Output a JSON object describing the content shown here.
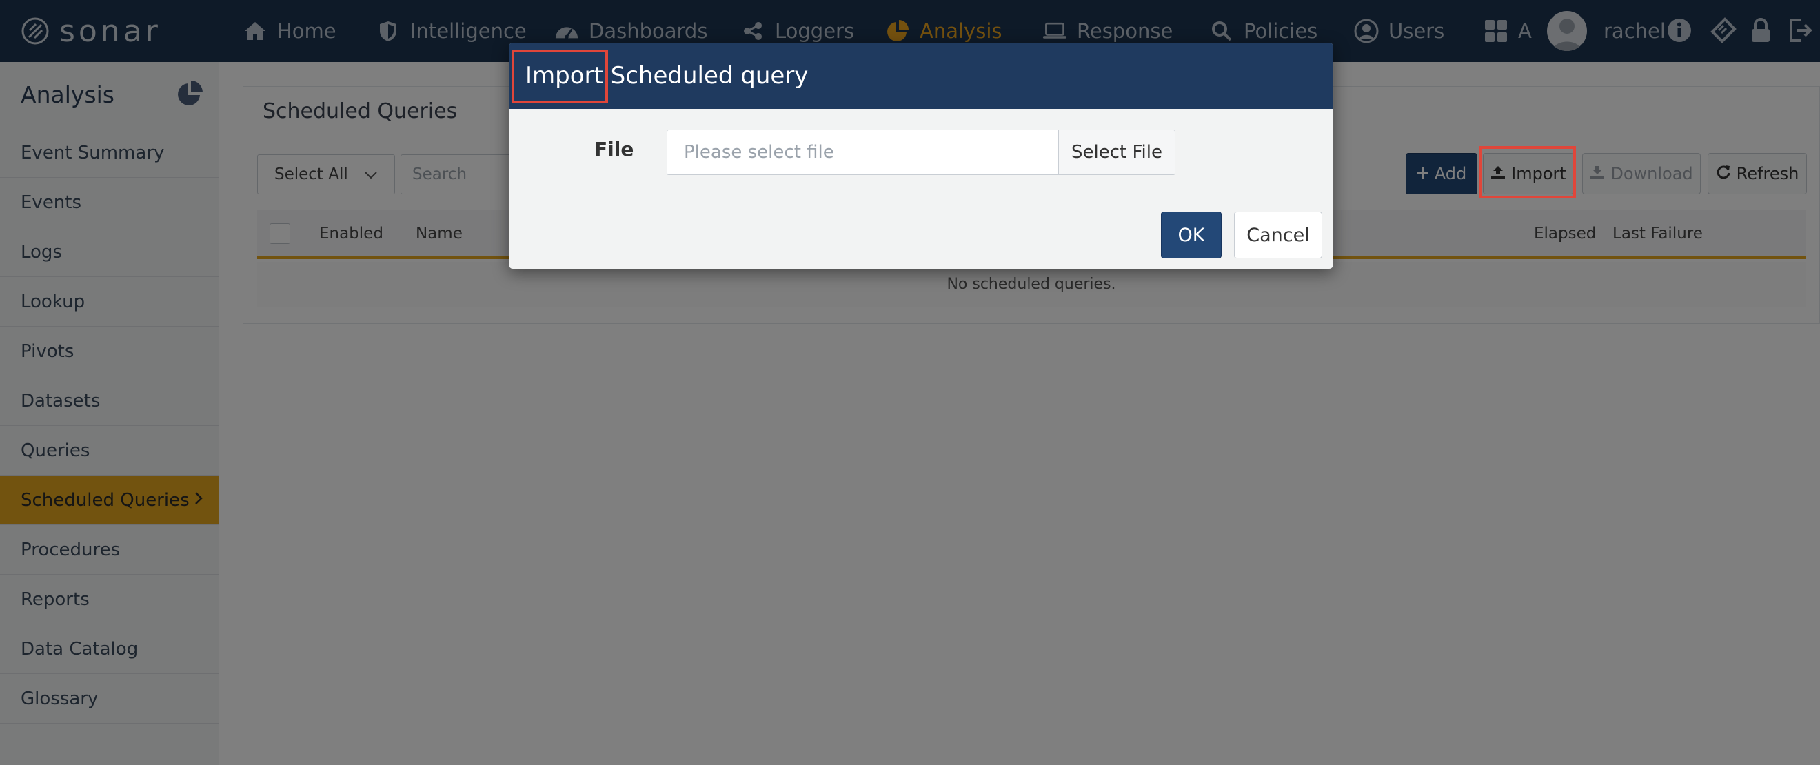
{
  "app": {
    "logo_text": "sonar"
  },
  "topnav": {
    "items": [
      {
        "label": "Home",
        "icon": "home-icon"
      },
      {
        "label": "Intelligence",
        "icon": "shield-icon"
      },
      {
        "label": "Dashboards",
        "icon": "gauge-icon"
      },
      {
        "label": "Loggers",
        "icon": "share-icon"
      },
      {
        "label": "Analysis",
        "icon": "pie-chart-icon",
        "active": true
      },
      {
        "label": "Response",
        "icon": "laptop-icon"
      },
      {
        "label": "Policies",
        "icon": "search-icon"
      },
      {
        "label": "Users",
        "icon": "user-circle-icon"
      },
      {
        "label": "A",
        "icon": "apps-grid-icon"
      }
    ],
    "username": "rachel",
    "active_color": "#e8a31e"
  },
  "sidebar": {
    "title": "Analysis",
    "items": [
      {
        "label": "Event Summary"
      },
      {
        "label": "Events"
      },
      {
        "label": "Logs"
      },
      {
        "label": "Lookup"
      },
      {
        "label": "Pivots"
      },
      {
        "label": "Datasets"
      },
      {
        "label": "Queries"
      },
      {
        "label": "Scheduled Queries",
        "active": true
      },
      {
        "label": "Procedures"
      },
      {
        "label": "Reports"
      },
      {
        "label": "Data Catalog"
      },
      {
        "label": "Glossary"
      }
    ],
    "active_color": "#e4a71f"
  },
  "main": {
    "title": "Scheduled Queries",
    "select_value": "Select All",
    "search_placeholder": "Search",
    "buttons": {
      "add": "Add",
      "import": "Import",
      "download": "Download",
      "refresh": "Refresh"
    },
    "columns": [
      "Enabled",
      "Name",
      "Elapsed",
      "Last Failure"
    ],
    "empty_text": "No scheduled queries."
  },
  "modal": {
    "title": "Import Scheduled query",
    "file_label": "File",
    "file_placeholder": "Please select file",
    "select_file_label": "Select File",
    "ok_label": "OK",
    "cancel_label": "Cancel",
    "header_color": "#1f3a5f"
  }
}
